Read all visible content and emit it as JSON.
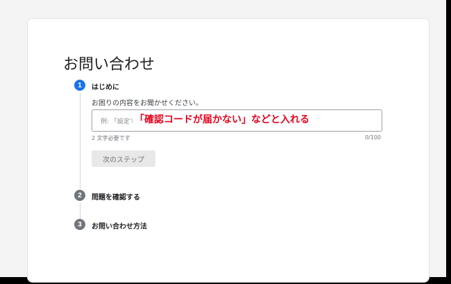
{
  "page": {
    "title": "お問い合わせ"
  },
  "steps": [
    {
      "number": "1",
      "label": "はじめに",
      "state": "active"
    },
    {
      "number": "2",
      "label": "問題を確認する",
      "state": "inactive"
    },
    {
      "number": "3",
      "label": "お問い合わせ方法",
      "state": "inactive"
    }
  ],
  "form": {
    "prompt": "お困りの内容をお聞かせください。",
    "placeholder": "例: 「設定で",
    "annotation": "「確認コードが届かない」などと入れる",
    "helper": "2 文字必要です",
    "counter": "0/100",
    "next_label": "次のステップ"
  },
  "colors": {
    "active_step": "#1a73e8",
    "inactive_step": "#70757a",
    "annotation": "#e8001c"
  }
}
